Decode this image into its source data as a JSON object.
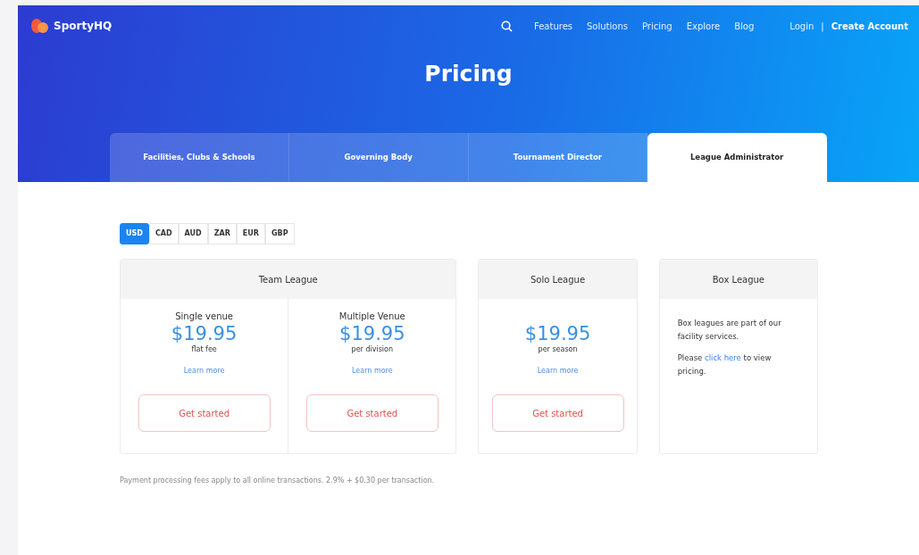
{
  "brand": {
    "name": "SportyHQ"
  },
  "nav": {
    "links": [
      "Features",
      "Solutions",
      "Pricing",
      "Explore",
      "Blog"
    ],
    "login": "Login",
    "separator": "|",
    "create_account": "Create Account"
  },
  "hero_title": "Pricing",
  "tabs": [
    {
      "label": "Facilities, Clubs & Schools",
      "selected": false
    },
    {
      "label": "Governing Body",
      "selected": false
    },
    {
      "label": "Tournament Director",
      "selected": false
    },
    {
      "label": "League Administrator",
      "selected": true
    }
  ],
  "currencies": [
    {
      "label": "USD",
      "selected": true
    },
    {
      "label": "CAD",
      "selected": false
    },
    {
      "label": "AUD",
      "selected": false
    },
    {
      "label": "ZAR",
      "selected": false
    },
    {
      "label": "EUR",
      "selected": false
    },
    {
      "label": "GBP",
      "selected": false
    }
  ],
  "cards": [
    {
      "kind": "plans",
      "title": "Team League",
      "plans": [
        {
          "name": "Single venue",
          "price": "$19.95",
          "unit": "flat fee",
          "link": "Learn more",
          "button": "Get started"
        },
        {
          "name": "Multiple Venue",
          "price": "$19.95",
          "unit": "per division",
          "link": "Learn more",
          "button": "Get started"
        }
      ]
    },
    {
      "kind": "plans",
      "title": "Solo League",
      "plans": [
        {
          "price": "$19.95",
          "unit": "per season",
          "link": "Learn more",
          "button": "Get started"
        }
      ]
    },
    {
      "kind": "info",
      "title": "Box League",
      "text": "Box leagues are part of our facility services.",
      "pre": "Please",
      "link": "click here",
      "post": "to view pricing."
    }
  ],
  "footnote": "Payment processing fees apply to all online transactions. 2.9% + $0.30 per transaction."
}
